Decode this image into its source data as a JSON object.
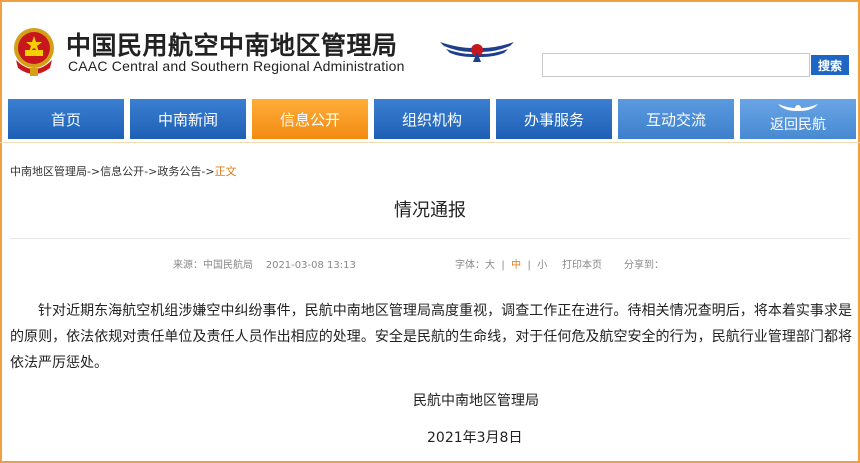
{
  "header": {
    "org_name_cn": "中国民用航空中南地区管理局",
    "org_name_en": "CAAC Central and Southern Regional Administration",
    "emblem_icon": "national-emblem-icon",
    "logo_icon": "caac-wing-logo-icon",
    "search": {
      "placeholder": "",
      "button_label": "搜索"
    }
  },
  "nav": {
    "items": [
      {
        "label": "首页"
      },
      {
        "label": "中南新闻"
      },
      {
        "label": "信息公开",
        "active": true
      },
      {
        "label": "组织机构"
      },
      {
        "label": "办事服务"
      },
      {
        "label": "互动交流"
      },
      {
        "label": "返回民航"
      }
    ],
    "colors": {
      "default": "#1e5fb4",
      "active": "#f28a12"
    }
  },
  "breadcrumb": {
    "items": [
      "中南地区管理局",
      "->信息公开",
      "->政务公告",
      "->"
    ],
    "current": "正文"
  },
  "article": {
    "title": "情况通报",
    "source": "来源：中国民航局",
    "datetime": "2021-03-08 13:13",
    "font_label": "字体：",
    "font_sizes": [
      "大",
      "中",
      "小"
    ],
    "font_selected": "中",
    "print_label": "打印本页",
    "share_label": "分享到：",
    "body": "针对近期东海航空机组涉嫌空中纠纷事件，民航中南地区管理局高度重视，调查工作正在进行。待相关情况查明后，将本着实事求是的原则，依法依规对责任单位及责任人员作出相应的处理。安全是民航的生命线，对于任何危及航空安全的行为，民航行业管理部门都将依法严厉惩处。",
    "signature": "民航中南地区管理局",
    "date": "2021年3月8日"
  },
  "colors": {
    "frame": "#f0a040",
    "accent": "#e07a16",
    "search_button": "#1e66c4"
  }
}
